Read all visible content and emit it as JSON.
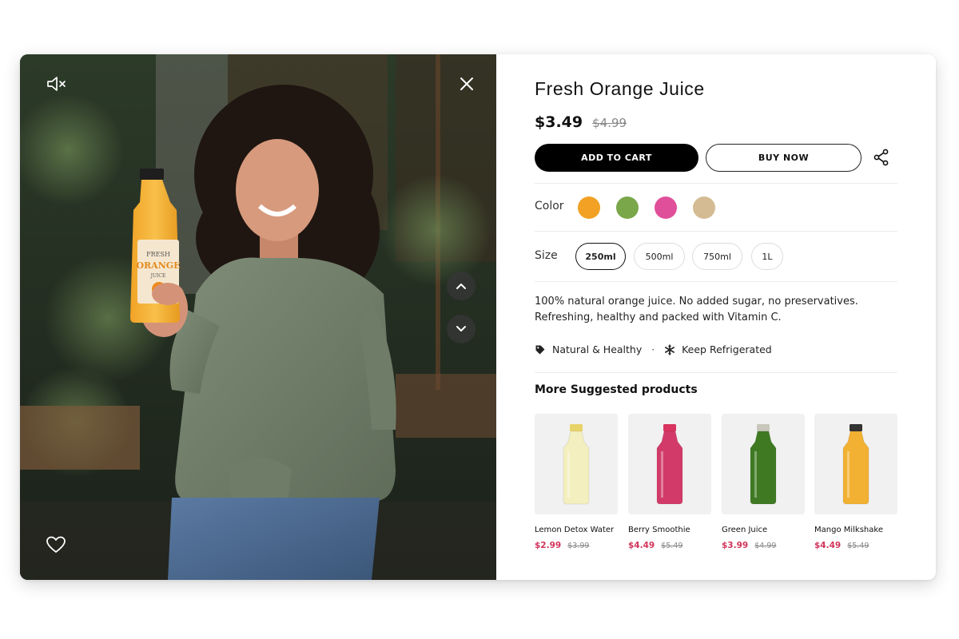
{
  "product": {
    "title": "Fresh Orange Juice",
    "price": "$3.49",
    "old_price": "$4.99",
    "add_to_cart_label": "ADD TO CART",
    "buy_now_label": "BUY NOW",
    "color_label": "Color",
    "colors": [
      "#f2a124",
      "#79a74a",
      "#e0509a",
      "#d4bb93"
    ],
    "size_label": "Size",
    "sizes": [
      {
        "label": "250ml",
        "selected": true
      },
      {
        "label": "500ml",
        "selected": false
      },
      {
        "label": "750ml",
        "selected": false
      },
      {
        "label": "1L",
        "selected": false
      }
    ],
    "description_line1": "100% natural orange juice. No added sugar, no preservatives.",
    "description_line2": "Refreshing, healthy and packed with Vitamin C.",
    "features": [
      {
        "icon": "tag-icon",
        "label": "Natural & Healthy"
      },
      {
        "icon": "snowflake-icon",
        "label": "Keep Refrigerated"
      }
    ],
    "feature_separator": "·"
  },
  "media": {
    "icons": [
      "mute-icon",
      "close-icon",
      "chevron-up-icon",
      "chevron-down-icon",
      "heart-icon"
    ],
    "bottle_label_line1": "FRESH",
    "bottle_label_line2": "ORANGE",
    "bottle_label_line3": "JUICE"
  },
  "suggestions": {
    "title": "More Suggested products",
    "items": [
      {
        "name": "Lemon Detox Water",
        "price": "$2.99",
        "old_price": "$3.99",
        "liquid": "#f3efbf",
        "cap": "#e8d36a"
      },
      {
        "name": "Berry Smoothie",
        "price": "$4.49",
        "old_price": "$5.49",
        "liquid": "#d23b69",
        "cap": "#d8345f"
      },
      {
        "name": "Green Juice",
        "price": "$3.99",
        "old_price": "$4.99",
        "liquid": "#3f7a23",
        "cap": "#c9c6bb"
      },
      {
        "name": "Mango Milkshake",
        "price": "$4.49",
        "old_price": "$5.49",
        "liquid": "#f2b132",
        "cap": "#333333"
      }
    ]
  },
  "colors": {
    "accent_price": "#d1355b",
    "primary_button": "#000000"
  }
}
